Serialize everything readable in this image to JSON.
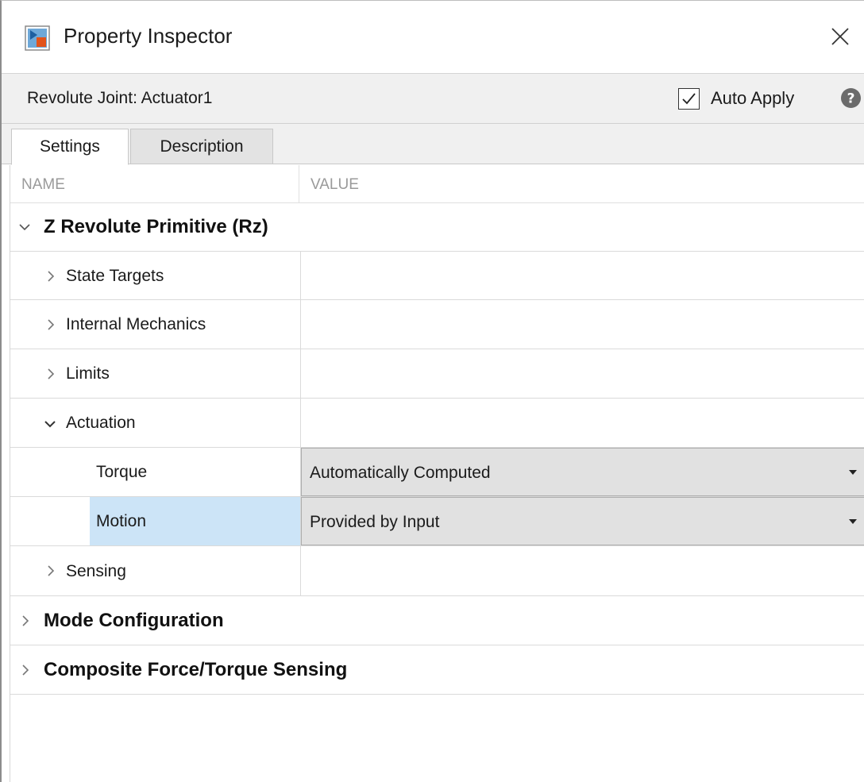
{
  "window": {
    "title": "Property Inspector"
  },
  "header": {
    "block_name": "Revolute Joint: Actuator1",
    "auto_apply_label": "Auto Apply",
    "auto_apply_checked": true
  },
  "tabs": [
    {
      "label": "Settings",
      "active": true
    },
    {
      "label": "Description",
      "active": false
    }
  ],
  "table": {
    "columns": {
      "name": "NAME",
      "value": "VALUE"
    },
    "rows": [
      {
        "label": "Z Revolute Primitive (Rz)",
        "expanded": true
      },
      {
        "label": "State Targets",
        "expanded": false
      },
      {
        "label": "Internal Mechanics",
        "expanded": false
      },
      {
        "label": "Limits",
        "expanded": false
      },
      {
        "label": "Actuation",
        "expanded": true
      },
      {
        "label": "Torque",
        "value": "Automatically Computed"
      },
      {
        "label": "Motion",
        "value": "Provided by Input"
      },
      {
        "label": "Sensing",
        "expanded": false
      },
      {
        "label": "Mode Configuration",
        "expanded": false
      },
      {
        "label": "Composite Force/Torque Sensing",
        "expanded": false
      }
    ]
  },
  "colors": {
    "selection": "#cce4f7",
    "dropdown_bg": "#e1e1e1",
    "header_bg": "#f0f0f0",
    "muted_text": "#9a9a9a"
  },
  "icons": {
    "app": "property-inspector-icon",
    "close": "close-icon",
    "help": "help-icon",
    "checkbox": "checkmark-icon",
    "expand": "chevron-right-icon",
    "collapse": "chevron-down-icon",
    "dropdown": "dropdown-arrow-icon"
  }
}
